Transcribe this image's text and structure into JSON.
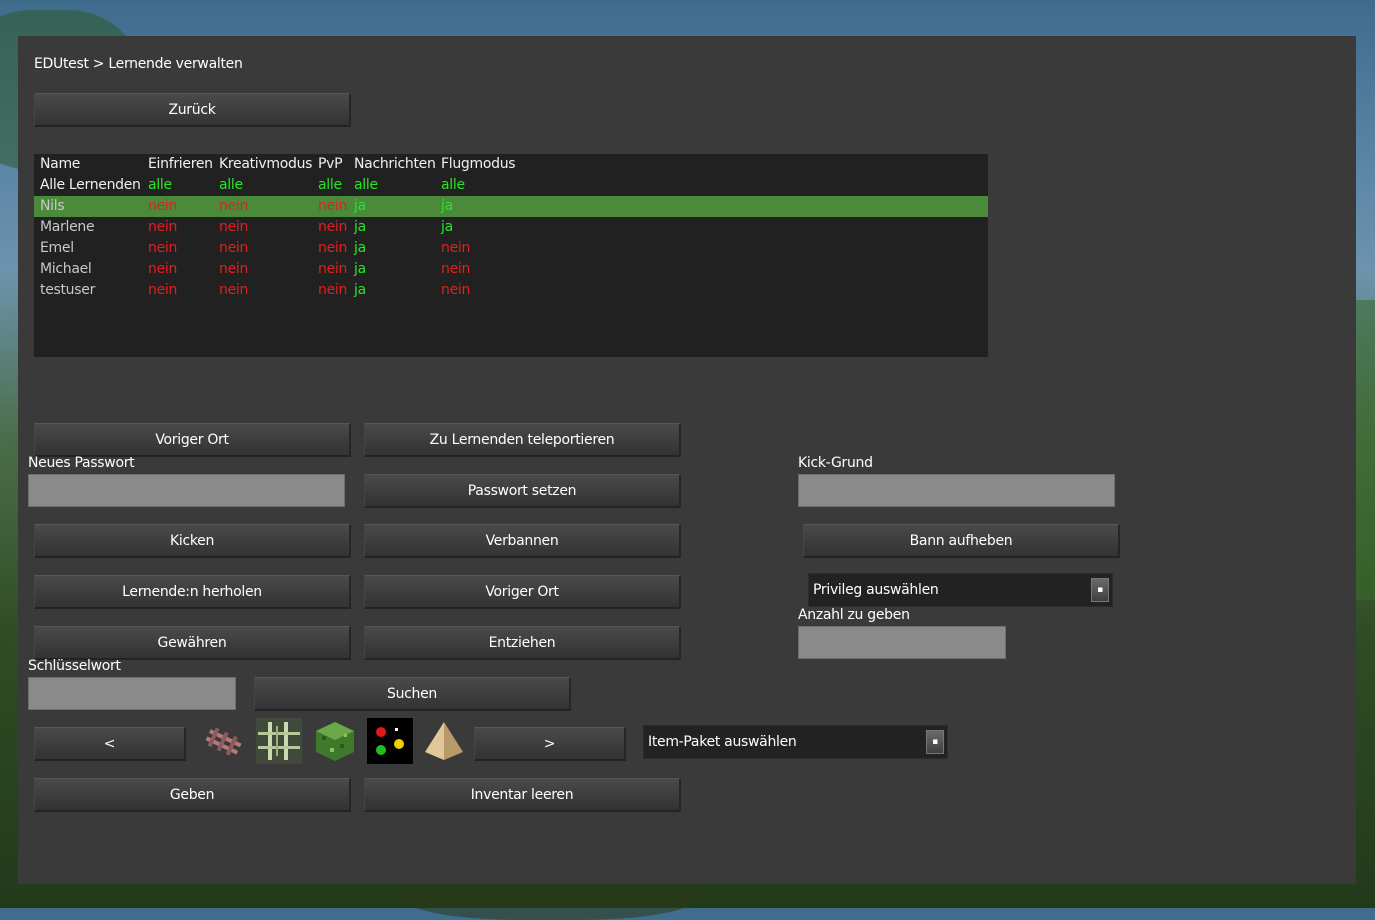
{
  "breadcrumb": "EDUtest > Lernende verwalten",
  "back_button": "Zurück",
  "table": {
    "headers": [
      "Name",
      "Einfrieren",
      "Kreativmodus",
      "PvP",
      "Nachrichten",
      "Flugmodus"
    ],
    "rows": [
      [
        "Alle Lernenden",
        "alle",
        "alle",
        "alle",
        "alle",
        "alle"
      ],
      [
        "Nils",
        "nein",
        "nein",
        "nein",
        "ja",
        "ja"
      ],
      [
        "Marlene",
        "nein",
        "nein",
        "nein",
        "ja",
        "ja"
      ],
      [
        "Emel",
        "nein",
        "nein",
        "nein",
        "ja",
        "nein"
      ],
      [
        "Michael",
        "nein",
        "nein",
        "nein",
        "ja",
        "nein"
      ],
      [
        "testuser",
        "nein",
        "nein",
        "nein",
        "ja",
        "nein"
      ]
    ],
    "selected_row": "Nils"
  },
  "buttons": {
    "previous_location_1": "Voriger Ort",
    "teleport_to_learner": "Zu Lernenden teleportieren",
    "set_password": "Passwort setzen",
    "kick": "Kicken",
    "ban": "Verbannen",
    "unban": "Bann aufheben",
    "bring_learner": "Lernende:n herholen",
    "previous_location_2": "Voriger Ort",
    "grant": "Gewähren",
    "revoke": "Entziehen",
    "search": "Suchen",
    "prev_page": "<",
    "next_page": ">",
    "give": "Geben",
    "clear_inventory": "Inventar leeren"
  },
  "labels": {
    "new_password": "Neues Passwort",
    "kick_reason": "Kick-Grund",
    "amount_to_give": "Anzahl zu geben",
    "keyword": "Schlüsselwort"
  },
  "inputs": {
    "new_password": "",
    "kick_reason": "",
    "amount_to_give": "",
    "keyword": ""
  },
  "dropdowns": {
    "privilege": "Privileg auswählen",
    "item_package": "Item-Paket auswählen"
  },
  "item_icons": [
    "rails-item-icon",
    "fence-item-icon",
    "leaves-block-icon",
    "traffic-light-item-icon",
    "sand-pyramid-item-icon"
  ],
  "colors": {
    "panel_bg": "#3a3a3a",
    "table_bg": "#212121",
    "selected_row": "#4a8a3a",
    "value_all": "#26e626",
    "value_yes": "#26e626",
    "value_no": "#e02020"
  }
}
